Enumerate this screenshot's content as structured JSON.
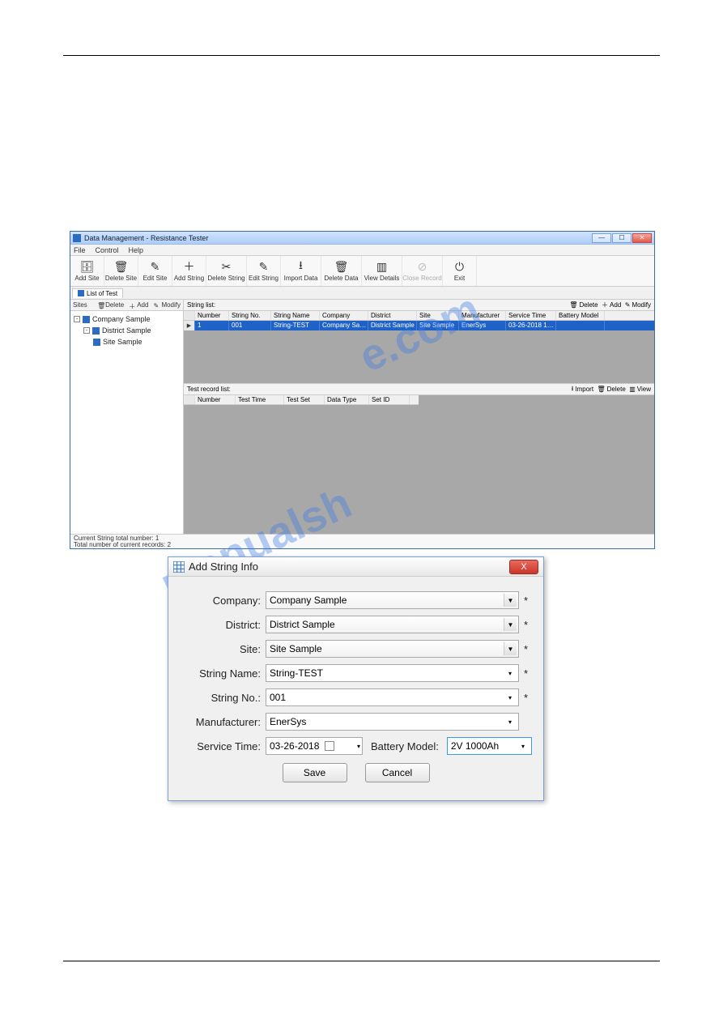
{
  "app": {
    "title": "Data Management - Resistance Tester",
    "menu": [
      "File",
      "Control",
      "Help"
    ],
    "toolbar": [
      {
        "label": "Add Site",
        "icon": "🗄"
      },
      {
        "label": "Delete Site",
        "icon": "🗑"
      },
      {
        "label": "Edit Site",
        "icon": "✎"
      },
      {
        "label": "Add String",
        "icon": "➕"
      },
      {
        "label": "Delete String",
        "icon": "✖"
      },
      {
        "label": "Edit String",
        "icon": "✎"
      },
      {
        "label": "Import Data",
        "icon": "📥"
      },
      {
        "label": "Delete Data",
        "icon": "🗑"
      },
      {
        "label": "View Details",
        "icon": "▥"
      },
      {
        "label": "Close Record",
        "icon": "⊘",
        "disabled": true
      },
      {
        "label": "Exit",
        "icon": "⏻"
      }
    ],
    "tab": "List of Test",
    "sites": {
      "header": "Sites",
      "btns": [
        "Delete",
        "Add",
        "Modify"
      ],
      "tree": [
        {
          "label": "Company Sample",
          "level": 0,
          "open": true
        },
        {
          "label": "District Sample",
          "level": 1,
          "open": true
        },
        {
          "label": "Site Sample",
          "level": 2
        }
      ]
    },
    "stringlist": {
      "header": "String list:",
      "btns": [
        "Delete",
        "Add",
        "Modify"
      ],
      "cols": [
        "Number",
        "String No.",
        "String Name",
        "Company",
        "District",
        "Site",
        "Manufacturer",
        "Service Time",
        "Battery Model"
      ],
      "row": {
        "number": "1",
        "sno": "001",
        "sname": "String-TEST",
        "company": "Company Sa…",
        "district": "District Sample",
        "site": "Site Sample",
        "manu": "EnerSys",
        "svc": "03-26-2018 1…",
        "bmod": ""
      }
    },
    "reclist": {
      "header": "Test record list:",
      "btns": [
        "Import",
        "Delete",
        "View"
      ],
      "cols": [
        "Number",
        "Test Time",
        "Test Set",
        "Data Type",
        "Set ID"
      ]
    },
    "status": {
      "l1": "Current String total number: 1",
      "l2": "Total number of current records: 2"
    }
  },
  "dialog": {
    "title": "Add String Info",
    "fields": {
      "company": {
        "label": "Company:",
        "value": "Company Sample",
        "req": "*"
      },
      "district": {
        "label": "District:",
        "value": "District Sample",
        "req": "*"
      },
      "site": {
        "label": "Site:",
        "value": "Site Sample",
        "req": "*"
      },
      "stringname": {
        "label": "String Name:",
        "value": "String-TEST",
        "req": "*"
      },
      "stringno": {
        "label": "String No.:",
        "value": "001",
        "req": "*"
      },
      "manufacturer": {
        "label": "Manufacturer:",
        "value": "EnerSys"
      },
      "servicetime": {
        "label": "Service Time:",
        "value": "03-26-2018"
      },
      "batterymodel": {
        "label": "Battery Model:",
        "value": "2V 1000Ah"
      }
    },
    "save": "Save",
    "cancel": "Cancel",
    "close": "X"
  },
  "watermark": {
    "a": "e.com",
    "b": "manualsh"
  }
}
